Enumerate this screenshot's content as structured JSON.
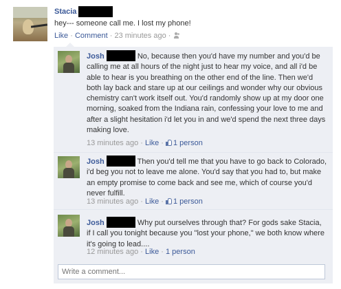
{
  "post": {
    "author": "Stacia",
    "text": "hey--- someone call me. I lost my phone!",
    "like_label": "Like",
    "sep": "·",
    "comment_label": "Comment",
    "time": "23 minutes ago"
  },
  "comments": [
    {
      "author": "Josh",
      "text": "No, because then you'd have my number and you'd be calling me at all hours of the night just to hear my voice, and all i'd be able to hear is you breathing on the other end of the line. Then we'd both lay back and stare up at our ceilings and wonder why our obvious chemistry can't work itself out. You'd randomly show up at my door one morning, soaked from the Indiana rain, confessing your love to me and after a slight hesitation i'd let you in and we'd spend the next three days making love.",
      "time": "13 minutes ago",
      "like_label": "Like",
      "likes": "1 person"
    },
    {
      "author": "Josh",
      "text": "Then you'd tell me that you have to go back to Colorado, i'd beg you not to leave me alone. You'd say that you had to, but make an empty promise to come back and see me, which of course you'd never fulfill.",
      "time": "13 minutes ago",
      "like_label": "Like",
      "likes": "1 person"
    },
    {
      "author": "Josh",
      "text": "Why put ourselves through that? For gods sake Stacia, if I call you tonight because you \"lost your phone,\" we both know where it's going to lead....",
      "time": "12 minutes ago",
      "like_label": "Like",
      "likes": "1 person"
    }
  ],
  "write_comment": {
    "placeholder": "Write a comment..."
  },
  "colors": {
    "link": "#3b5998",
    "meta": "#999999",
    "comment_bg": "#edeff4"
  },
  "icons": {
    "people": "people-icon",
    "like": "thumbs-up-icon"
  }
}
